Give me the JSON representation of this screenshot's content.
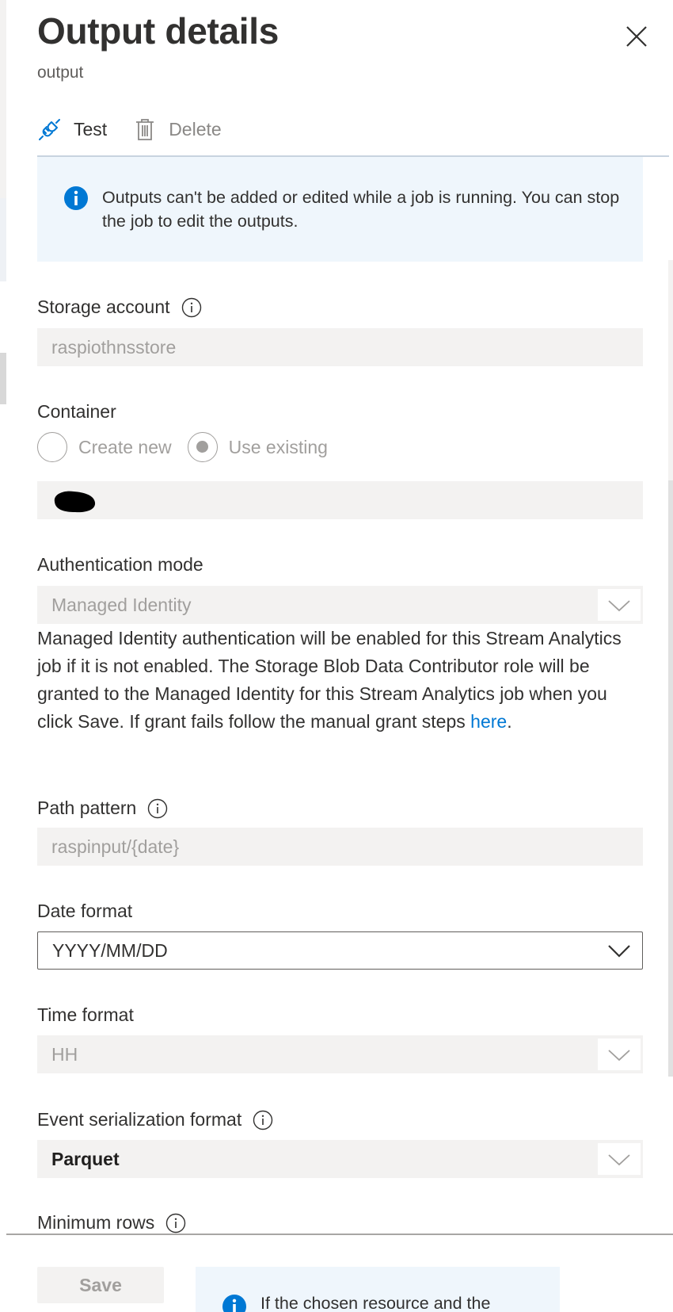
{
  "header": {
    "title": "Output details",
    "subtitle": "output"
  },
  "toolbar": {
    "test_label": "Test",
    "delete_label": "Delete"
  },
  "info_bar": {
    "text": "Outputs can't be added or edited while a job is running. You can stop the job to edit the outputs."
  },
  "form": {
    "storage_account": {
      "label": "Storage account",
      "value": "raspiothnsstore"
    },
    "container": {
      "label": "Container",
      "options": [
        "Create new",
        "Use existing"
      ],
      "selected": "Use existing",
      "value": ""
    },
    "authentication_mode": {
      "label": "Authentication mode",
      "value": "Managed Identity",
      "help_text": "Managed Identity authentication will be enabled for this Stream Analytics job if it is not enabled. The Storage Blob Data Contributor role will be granted to the Managed Identity for this Stream Analytics job when you click Save. If grant fails follow the manual grant steps ",
      "help_link": "here",
      "help_suffix": "."
    },
    "path_pattern": {
      "label": "Path pattern",
      "value": "raspinput/{date}"
    },
    "date_format": {
      "label": "Date format",
      "value": "YYYY/MM/DD"
    },
    "time_format": {
      "label": "Time format",
      "value": "HH"
    },
    "event_serialization_format": {
      "label": "Event serialization format",
      "value": "Parquet"
    },
    "minimum_rows": {
      "label": "Minimum rows"
    }
  },
  "footer": {
    "save_label": "Save",
    "info_text": "If the chosen resource and the"
  },
  "colors": {
    "accent": "#0078d4",
    "info_background": "#eff6fc",
    "disabled_field": "#f3f2f1"
  }
}
